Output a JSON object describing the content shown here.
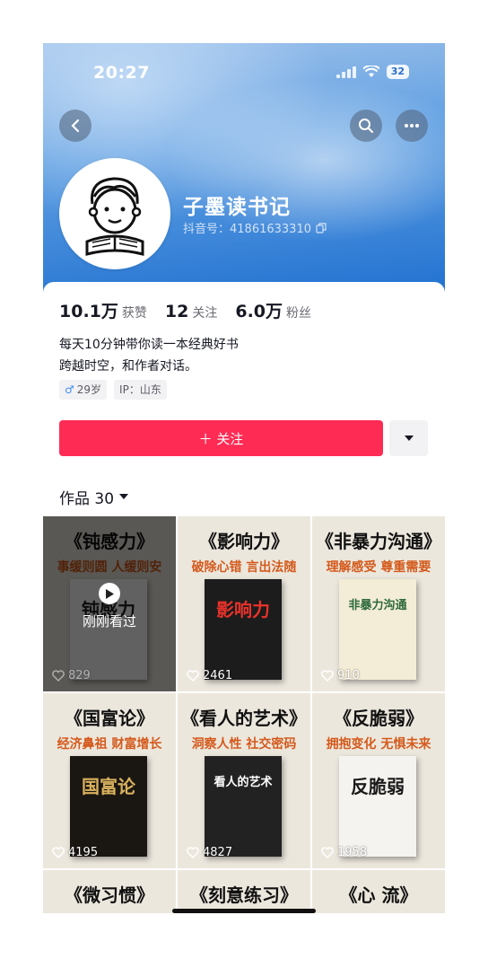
{
  "status": {
    "time": "20:27",
    "battery": "32"
  },
  "profile": {
    "name": "子墨读书记",
    "douyin_id": "抖音号：41861633310"
  },
  "stats": [
    {
      "value": "10.1万",
      "label": "获赞"
    },
    {
      "value": "12",
      "label": "关注"
    },
    {
      "value": "6.0万",
      "label": "粉丝"
    }
  ],
  "bio": [
    "每天10分钟带你读一本经典好书",
    "跨越时空，和作者对话。"
  ],
  "tags": {
    "gender": "♂",
    "age": "29岁",
    "ip": "IP：山东"
  },
  "follow_label": "＋ 关注",
  "works_label": "作品 30",
  "watched_label": "刚刚看过",
  "videos": [
    {
      "title": "《钝感力》",
      "subtitle": "事缓则圆 人缓则安",
      "likes": "829",
      "book_text": "钝感力",
      "book_color": "#ffffff",
      "book_text_color": "#222222",
      "watched": true
    },
    {
      "title": "《影响力》",
      "subtitle": "破除心错 言出法随",
      "likes": "2461",
      "book_text": "影响力",
      "book_color": "#1c1c1c",
      "book_text_color": "#e8322b",
      "watched": false
    },
    {
      "title": "《非暴力沟通》",
      "subtitle": "理解感受 尊重需要",
      "likes": "910",
      "book_text": "非暴力沟通",
      "book_color": "#f3ecd6",
      "book_text_color": "#2b6a3a",
      "watched": false
    },
    {
      "title": "《国富论》",
      "subtitle": "经济鼻祖 财富增长",
      "likes": "4195",
      "book_text": "国富论",
      "book_color": "#1a1612",
      "book_text_color": "#d9b15e",
      "watched": false
    },
    {
      "title": "《看人的艺术》",
      "subtitle": "洞察人性 社交密码",
      "likes": "4827",
      "book_text": "看人的艺术",
      "book_color": "#222222",
      "book_text_color": "#ffffff",
      "watched": false
    },
    {
      "title": "《反脆弱》",
      "subtitle": "拥抱变化 无惧未来",
      "likes": "1958",
      "book_text": "反脆弱",
      "book_color": "#f5f3ef",
      "book_text_color": "#1a1a1a",
      "watched": false
    },
    {
      "title": "《微习惯》",
      "subtitle": "",
      "likes": "",
      "book_text": "",
      "book_color": "#ece7dd",
      "book_text_color": "#111111",
      "watched": false
    },
    {
      "title": "《刻意练习》",
      "subtitle": "",
      "likes": "",
      "book_text": "",
      "book_color": "#ece7dd",
      "book_text_color": "#111111",
      "watched": false
    },
    {
      "title": "《心 流》",
      "subtitle": "",
      "likes": "",
      "book_text": "",
      "book_color": "#ece7dd",
      "book_text_color": "#111111",
      "watched": false
    }
  ],
  "colors": {
    "accent": "#fe2c55",
    "subtitle": "#d45a1c"
  },
  "icons": [
    "back-arrow-icon",
    "search-icon",
    "more-icon",
    "copy-icon",
    "chevron-down-icon",
    "heart-icon",
    "play-icon"
  ]
}
